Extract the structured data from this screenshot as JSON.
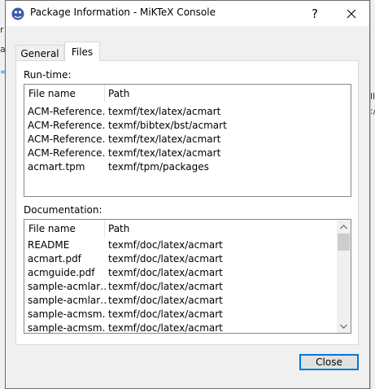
{
  "window": {
    "title": "Package Information - MiKTeX Console",
    "help_label": "?",
    "close_icon": "close-icon",
    "app_icon": "miktex-icon"
  },
  "tabs": [
    {
      "label": "General",
      "selected": false
    },
    {
      "label": "Files",
      "selected": true
    }
  ],
  "runtime": {
    "label": "Run-time:",
    "columns": [
      "File name",
      "Path"
    ],
    "rows": [
      {
        "name": "ACM-Reference…",
        "path": "texmf/tex/latex/acmart"
      },
      {
        "name": "ACM-Reference…",
        "path": "texmf/bibtex/bst/acmart"
      },
      {
        "name": "ACM-Reference…",
        "path": "texmf/tex/latex/acmart"
      },
      {
        "name": "ACM-Reference…",
        "path": "texmf/tex/latex/acmart"
      },
      {
        "name": "acmart.tpm",
        "path": "texmf/tpm/packages"
      }
    ]
  },
  "documentation": {
    "label": "Documentation:",
    "columns": [
      "File name",
      "Path"
    ],
    "rows": [
      {
        "name": "README",
        "path": "texmf/doc/latex/acmart"
      },
      {
        "name": "acmart.pdf",
        "path": "texmf/doc/latex/acmart"
      },
      {
        "name": "acmguide.pdf",
        "path": "texmf/doc/latex/acmart"
      },
      {
        "name": "sample-acmlar…",
        "path": "texmf/doc/latex/acmart"
      },
      {
        "name": "sample-acmlar…",
        "path": "texmf/doc/latex/acmart"
      },
      {
        "name": "sample-acmsm…",
        "path": "texmf/doc/latex/acmart"
      },
      {
        "name": "sample-acmsm…",
        "path": "texmf/doc/latex/acmart"
      }
    ]
  },
  "buttons": {
    "close_label": "Close"
  },
  "background": {
    "left_marks": [
      "r",
      "al",
      "="
    ],
    "right_marks": [
      "lle",
      ":/"
    ]
  },
  "colors": {
    "accent": "#0078d7",
    "dialog_bg": "#f0f0f0"
  }
}
